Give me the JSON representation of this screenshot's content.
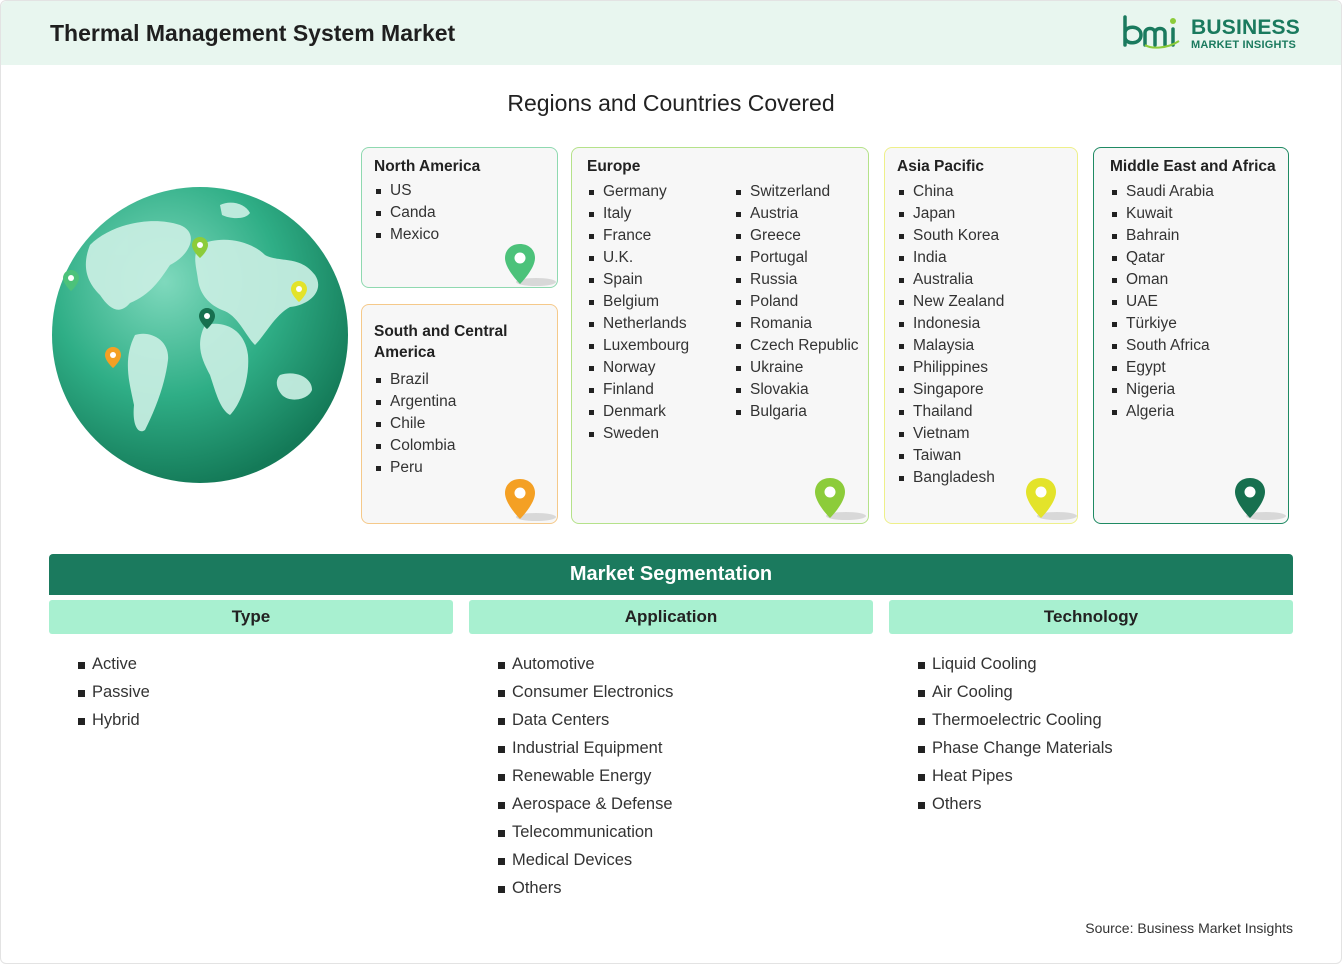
{
  "header": {
    "title": "Thermal Management System Market",
    "logo": {
      "line1": "BUSINESS",
      "line2": "MARKET INSIGHTS",
      "brand_color": "#1a7a5e"
    }
  },
  "regions": {
    "title": "Regions and Countries Covered",
    "north_america": {
      "title": "North America",
      "countries": [
        "US",
        "Canda",
        "Mexico"
      ],
      "border": "#8fd9b0",
      "pin": "#4cc27a"
    },
    "south_america": {
      "title": "South and Central America",
      "countries": [
        "Brazil",
        "Argentina",
        "Chile",
        "Colombia",
        "Peru"
      ],
      "border": "#f5c98a",
      "pin": "#f4a024"
    },
    "europe": {
      "title": "Europe",
      "countries_col1": [
        "Germany",
        "Italy",
        "France",
        "U.K.",
        "Spain",
        "Belgium",
        "Netherlands",
        "Luxembourg",
        "Norway",
        "Finland",
        "Denmark",
        "Sweden"
      ],
      "countries_col2": [
        "Switzerland",
        "Austria",
        "Greece",
        "Portugal",
        "Russia",
        "Poland",
        "Romania",
        "Czech Republic",
        "Ukraine",
        "Slovakia",
        "Bulgaria"
      ],
      "border": "#b5e28a",
      "pin": "#8ccc3a"
    },
    "asia_pacific": {
      "title": "Asia Pacific",
      "countries": [
        "China",
        "Japan",
        "South Korea",
        "India",
        "Australia",
        "New Zealand",
        "Indonesia",
        "Malaysia",
        "Philippines",
        "Singapore",
        "Thailand",
        "Vietnam",
        "Taiwan",
        "Bangladesh"
      ],
      "border": "#eef08a",
      "pin": "#e3e32a"
    },
    "middle_east_africa": {
      "title": "Middle East and Africa",
      "countries": [
        "Saudi Arabia",
        "Kuwait",
        "Bahrain",
        "Qatar",
        "Oman",
        "UAE",
        "Türkiye",
        "South Africa",
        "Egypt",
        "Nigeria",
        "Algeria"
      ],
      "border": "#1f8a63",
      "pin": "#17704f"
    }
  },
  "segmentation": {
    "title": "Market Segmentation",
    "columns": [
      {
        "heading": "Type",
        "items": [
          "Active",
          "Passive",
          "Hybrid"
        ]
      },
      {
        "heading": "Application",
        "items": [
          "Automotive",
          "Consumer Electronics",
          "Data Centers",
          "Industrial Equipment",
          "Renewable Energy",
          "Aerospace & Defense",
          "Telecommunication",
          "Medical Devices",
          "Others"
        ]
      },
      {
        "heading": "Technology",
        "items": [
          "Liquid Cooling",
          "Air Cooling",
          "Thermoelectric Cooling",
          "Phase Change Materials",
          "Heat Pipes",
          "Others"
        ]
      }
    ]
  },
  "source": "Source: Business Market Insights"
}
